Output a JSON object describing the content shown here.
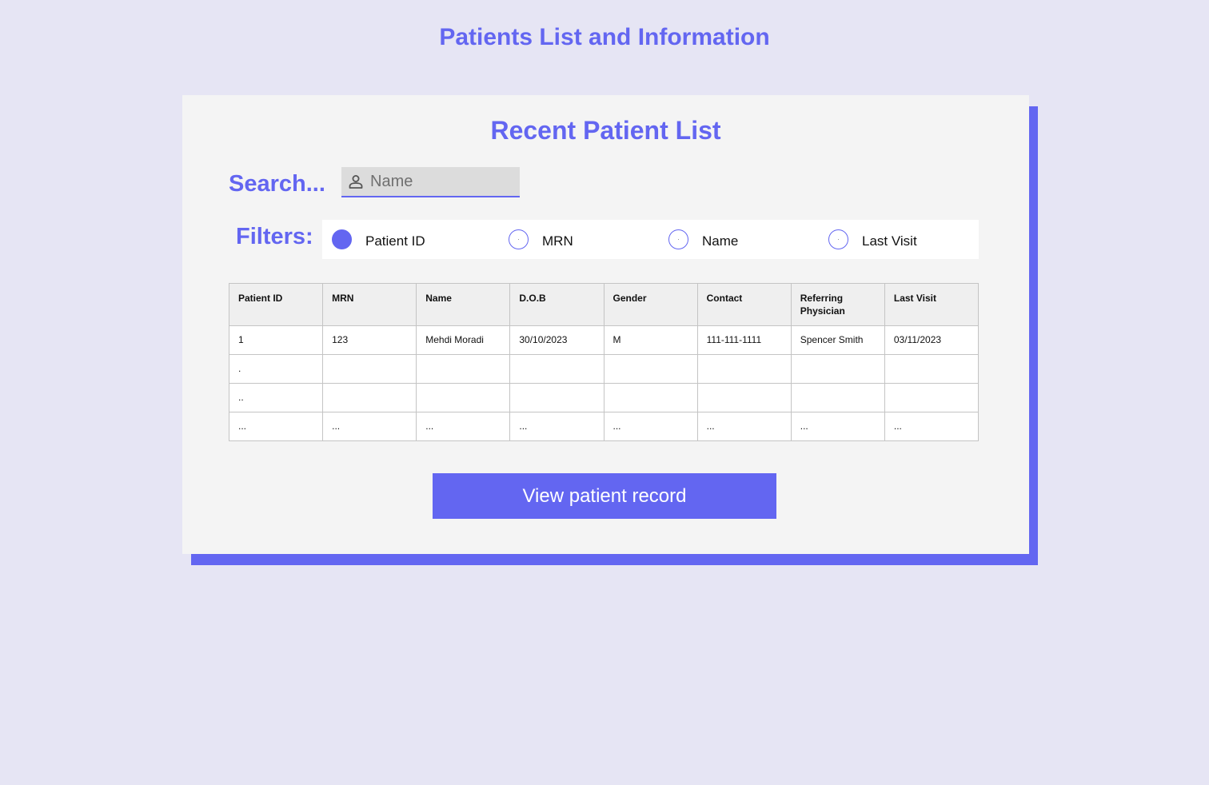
{
  "page": {
    "title": "Patients List and Information"
  },
  "card": {
    "title": "Recent Patient List"
  },
  "search": {
    "label": "Search...",
    "placeholder": "Name",
    "value": "",
    "icon": "person-icon"
  },
  "filters": {
    "label": "Filters:",
    "options": [
      {
        "label": "Patient ID",
        "selected": true
      },
      {
        "label": "MRN",
        "selected": false
      },
      {
        "label": "Name",
        "selected": false
      },
      {
        "label": "Last Visit",
        "selected": false
      }
    ]
  },
  "table": {
    "headers": [
      "Patient ID",
      "MRN",
      "Name",
      "D.O.B",
      "Gender",
      "Contact",
      "Referring Physician",
      "Last Visit"
    ],
    "rows": [
      [
        "1",
        "123",
        "Mehdi Moradi",
        "30/10/2023",
        "M",
        "111-111-1111",
        "Spencer Smith",
        "03/11/2023"
      ],
      [
        ".",
        "",
        "",
        "",
        "",
        "",
        "",
        ""
      ],
      [
        "..",
        "",
        "",
        "",
        "",
        "",
        "",
        ""
      ],
      [
        "...",
        "...",
        "...",
        "...",
        "...",
        "...",
        "...",
        "..."
      ]
    ]
  },
  "button": {
    "label": "View patient record"
  },
  "colors": {
    "accent": "#6366f1",
    "background": "#e6e5f4",
    "card": "#f4f4f4"
  }
}
